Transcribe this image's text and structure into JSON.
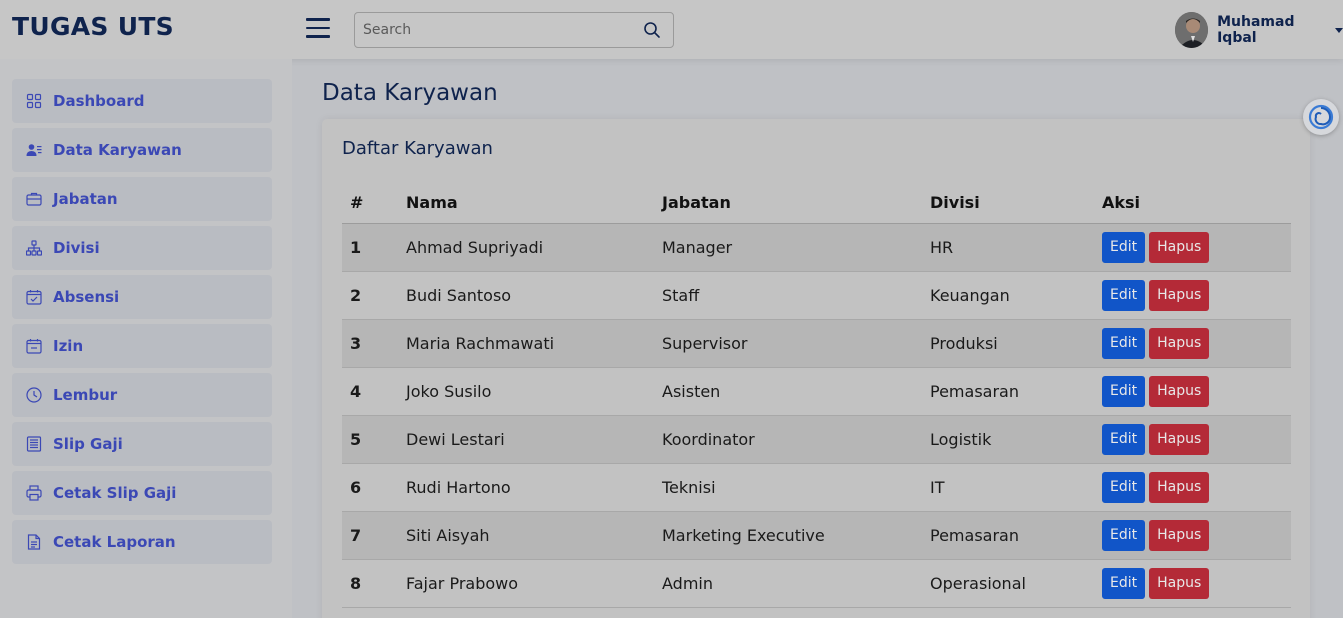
{
  "header": {
    "logo": "TUGAS UTS",
    "search_placeholder": "Search",
    "user_name": "Muhamad Iqbal"
  },
  "sidebar": {
    "items": [
      {
        "label": "Dashboard",
        "icon": "grid-icon"
      },
      {
        "label": "Data Karyawan",
        "icon": "users-icon"
      },
      {
        "label": "Jabatan",
        "icon": "briefcase-icon"
      },
      {
        "label": "Divisi",
        "icon": "sitemap-icon"
      },
      {
        "label": "Absensi",
        "icon": "calendar-check-icon"
      },
      {
        "label": "Izin",
        "icon": "calendar-icon"
      },
      {
        "label": "Lembur",
        "icon": "clock-icon"
      },
      {
        "label": "Slip Gaji",
        "icon": "receipt-icon"
      },
      {
        "label": "Cetak Slip Gaji",
        "icon": "printer-icon"
      },
      {
        "label": "Cetak Laporan",
        "icon": "document-icon"
      }
    ]
  },
  "main": {
    "page_title": "Data Karyawan",
    "card_title": "Daftar Karyawan",
    "table": {
      "headers": [
        "#",
        "Nama",
        "Jabatan",
        "Divisi",
        "Aksi"
      ],
      "rows": [
        [
          "1",
          "Ahmad Supriyadi",
          "Manager",
          "HR"
        ],
        [
          "2",
          "Budi Santoso",
          "Staff",
          "Keuangan"
        ],
        [
          "3",
          "Maria Rachmawati",
          "Supervisor",
          "Produksi"
        ],
        [
          "4",
          "Joko Susilo",
          "Asisten",
          "Pemasaran"
        ],
        [
          "5",
          "Dewi Lestari",
          "Koordinator",
          "Logistik"
        ],
        [
          "6",
          "Rudi Hartono",
          "Teknisi",
          "IT"
        ],
        [
          "7",
          "Siti Aisyah",
          "Marketing Executive",
          "Pemasaran"
        ],
        [
          "8",
          "Fajar Prabowo",
          "Admin",
          "Operasional"
        ]
      ],
      "edit_label": "Edit",
      "delete_label": "Hapus"
    }
  },
  "colors": {
    "brand": "#0f234d",
    "nav_text": "#3b48b5",
    "edit_button": "#1155c8",
    "delete_button": "#b42a37"
  }
}
